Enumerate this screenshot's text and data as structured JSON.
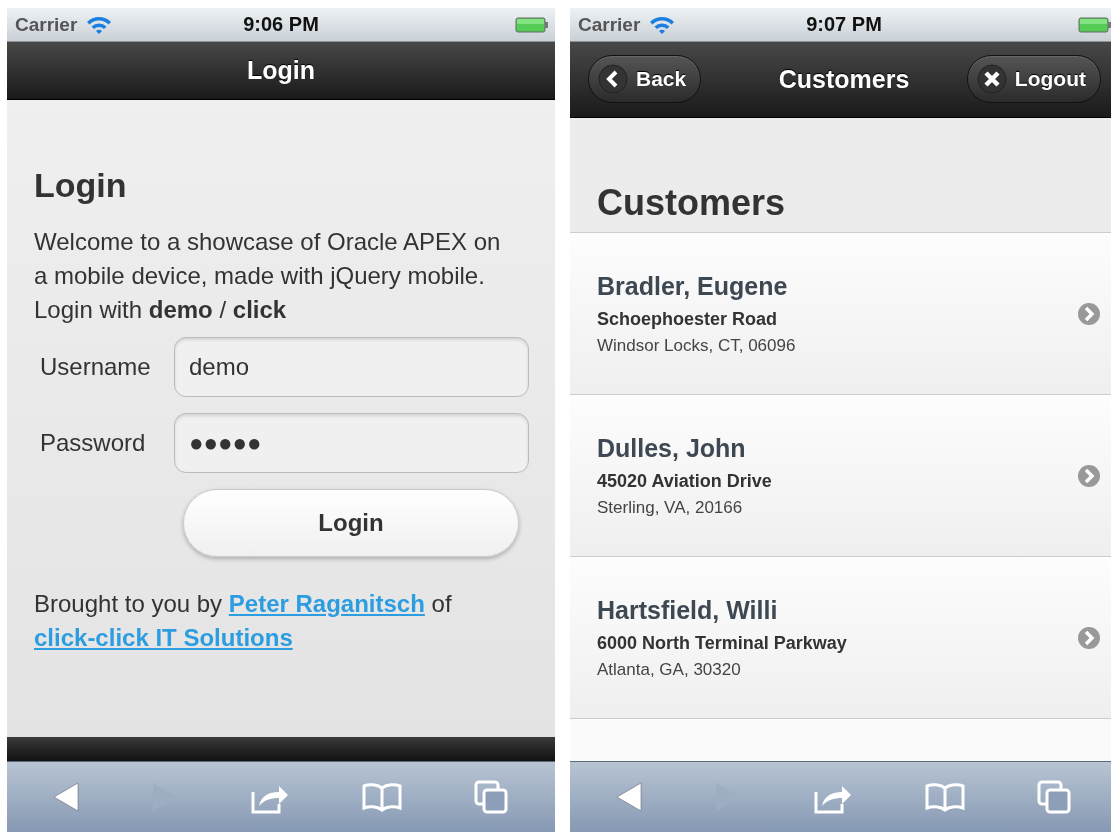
{
  "screens": [
    {
      "kind": "login",
      "status_bar": {
        "carrier": "Carrier",
        "time": "9:06 PM"
      },
      "header": {
        "title": "Login"
      },
      "heading": "Login",
      "intro": "Welcome to a showcase of Oracle APEX on a mobile device, made with jQuery mobile.",
      "hint": "Login with **demo** / **click**",
      "fields": [
        {
          "label": "Username",
          "value": "demo"
        },
        {
          "label": "Password",
          "value": "●●●●●"
        }
      ],
      "button": "Login",
      "credit": {
        "text": "Brought to you by",
        "author": "Peter Raganitsch",
        "joiner": "of",
        "company": "click-click IT Solutions"
      },
      "toolbar": {
        "forward_disabled": true
      }
    },
    {
      "kind": "list",
      "status_bar": {
        "carrier": "Carrier",
        "time": "9:07 PM"
      },
      "header": {
        "back": "Back",
        "title": "Customers",
        "logout": "Logout"
      },
      "heading": "Customers",
      "customers": [
        {
          "name": "Bradler, Eugene",
          "street": "Schoephoester Road",
          "city": "Windsor Locks, CT, 06096"
        },
        {
          "name": "Dulles, John",
          "street": "45020 Aviation Drive",
          "city": "Sterling, VA, 20166"
        },
        {
          "name": "Hartsfield, Willi",
          "street": "6000 North Terminal Parkway",
          "city": "Atlanta, GA, 30320"
        }
      ],
      "toolbar": {
        "forward_disabled": true
      }
    }
  ]
}
